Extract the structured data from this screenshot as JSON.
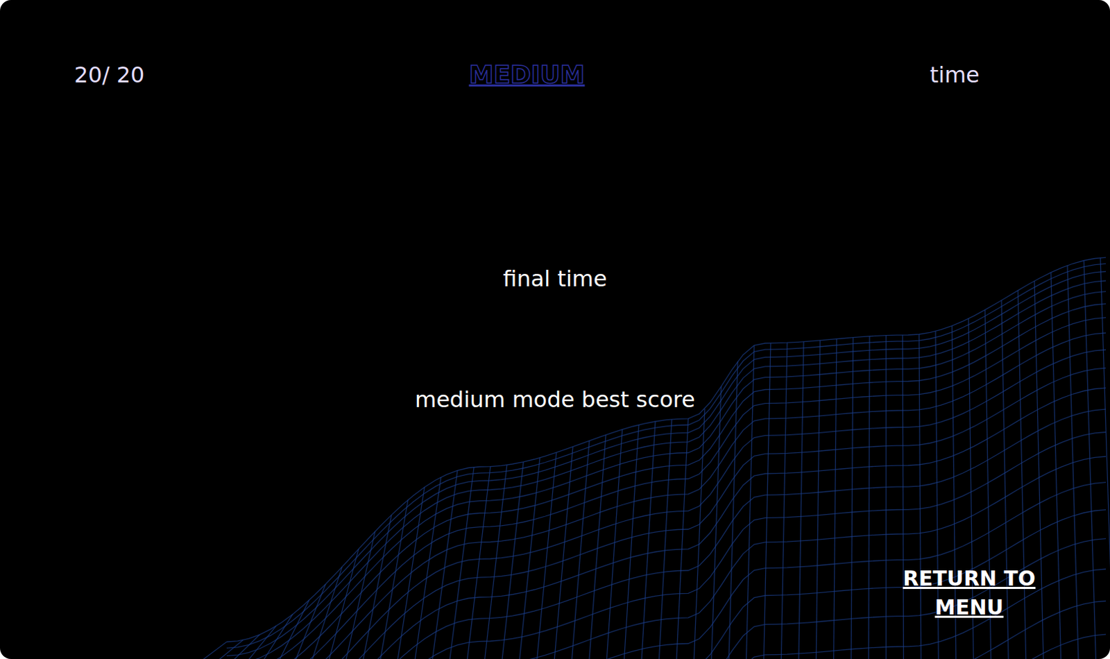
{
  "header": {
    "progress": "20/ 20",
    "mode": "MEDIUM",
    "time_label": "time"
  },
  "results": {
    "final_time_label": "final time",
    "best_score_label": "medium mode best score"
  },
  "buttons": [
    "RETURN TO MENU"
  ]
}
